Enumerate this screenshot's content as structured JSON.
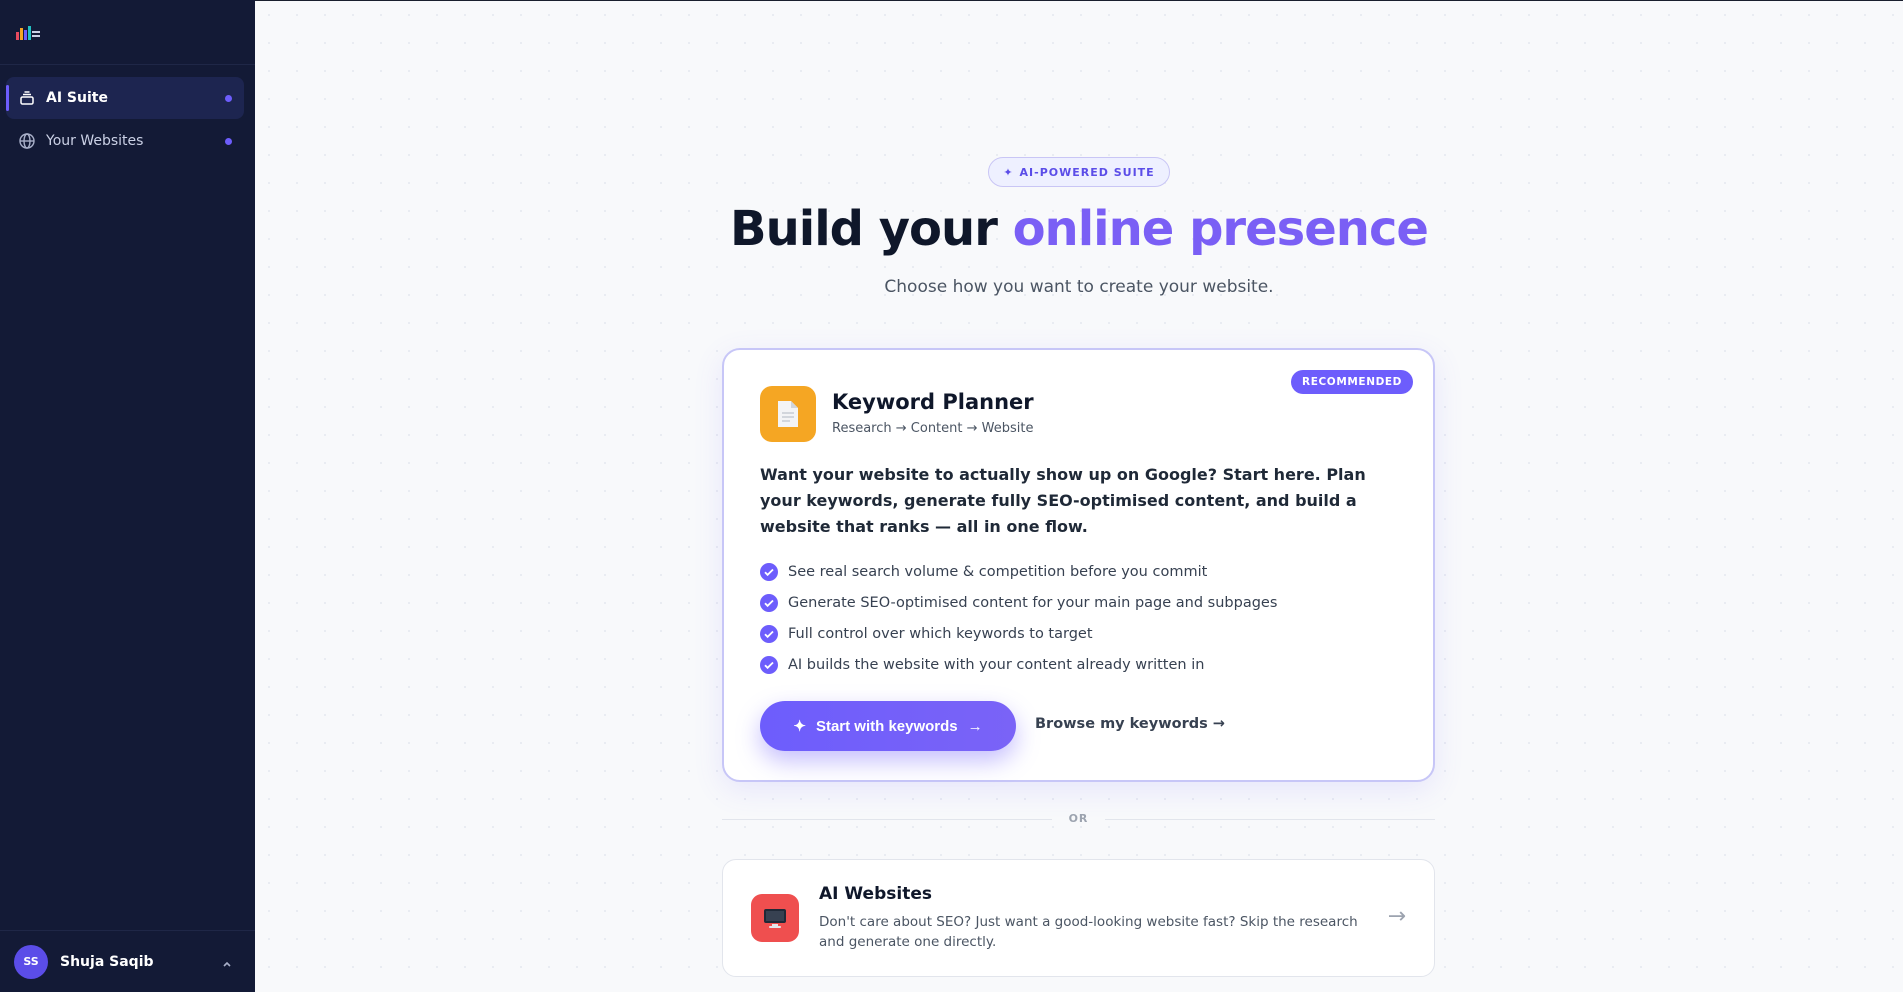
{
  "sidebar": {
    "items": [
      {
        "label": "AI Suite",
        "icon": "stack-icon",
        "active": true
      },
      {
        "label": "Your Websites",
        "icon": "globe-icon",
        "active": false
      }
    ],
    "user": {
      "initials": "SS",
      "name": "Shuja Saqib"
    }
  },
  "hero": {
    "pill": "AI-POWERED SUITE",
    "headline_main": "Build your ",
    "headline_accent": "online presence",
    "subtitle": "Choose how you want to create your website."
  },
  "keyword_planner": {
    "badge": "RECOMMENDED",
    "title": "Keyword Planner",
    "subtitle": "Research → Content → Website",
    "description": "Want your website to actually show up on Google? Start here. Plan your keywords, generate fully SEO-optimised content, and build a website that ranks — all in one flow.",
    "features": [
      "See real search volume & competition before you commit",
      "Generate SEO-optimised content for your main page and subpages",
      "Full control over which keywords to target",
      "AI builds the website with your content already written in"
    ],
    "primary_button": "Start with keywords",
    "secondary_link": "Browse my keywords →"
  },
  "divider": {
    "label": "OR"
  },
  "ai_websites": {
    "title": "AI Websites",
    "description": "Don't care about SEO? Just want a good-looking website fast? Skip the research and generate one directly."
  },
  "colors": {
    "accent": "#6d5dfc",
    "sidebar": "#131a36",
    "keyword_icon_bg": "#f5a623",
    "website_icon_bg": "#ef4f4f"
  }
}
